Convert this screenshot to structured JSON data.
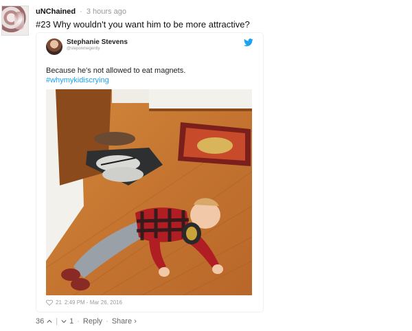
{
  "comment": {
    "username": "uNChained",
    "time_ago": "3 hours ago",
    "text": "#23 Why wouldn't you want him to be more attractive?"
  },
  "tweet": {
    "author_name": "Stephanie Stevens",
    "author_handle": "@steponmegently",
    "text": "Because he's not allowed to eat magnets.",
    "hashtag": "#whymykidiscrying",
    "likes": "21",
    "timestamp": "2:49 PM - Mar 26, 2016",
    "brand_color": "#1da1f2"
  },
  "actions": {
    "upvotes": "36",
    "downvotes": "1",
    "reply_label": "Reply",
    "share_label": "Share ›"
  }
}
